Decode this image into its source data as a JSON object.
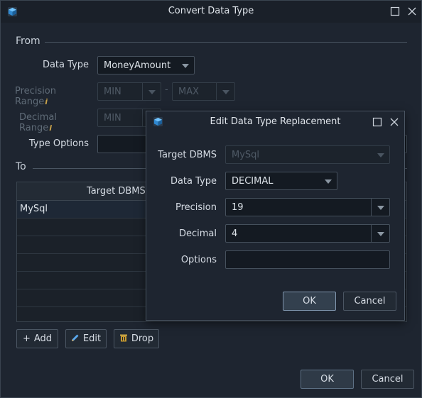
{
  "window": {
    "title": "Convert Data Type",
    "app_icon": "app-cube-icon"
  },
  "from": {
    "group_label": "From",
    "data_type_label": "Data Type",
    "data_type_value": "MoneyAmount",
    "precision_label": "Precision Range",
    "precision_min": "MIN",
    "precision_max": "MAX",
    "precision_dash": "-",
    "decimal_label": "Decimal Range",
    "decimal_min": "MIN",
    "info_glyph": "i",
    "type_options_label": "Type Options",
    "type_options_value": ""
  },
  "to": {
    "group_label": "To",
    "table": {
      "header": "Target DBMS",
      "rows": [
        {
          "target_dbms": "MySql"
        }
      ]
    },
    "add_label": "Add",
    "edit_label": "Edit",
    "drop_label": "Drop"
  },
  "footer": {
    "ok_label": "OK",
    "cancel_label": "Cancel"
  },
  "dialog": {
    "title": "Edit Data Type Replacement",
    "target_dbms_label": "Target DBMS",
    "target_dbms_value": "MySql",
    "data_type_label": "Data Type",
    "data_type_value": "DECIMAL",
    "precision_label": "Precision",
    "precision_value": "19",
    "decimal_label": "Decimal",
    "decimal_value": "4",
    "options_label": "Options",
    "options_value": "",
    "ok_label": "OK",
    "cancel_label": "Cancel"
  },
  "colors": {
    "background": "#1e2530",
    "accent_icon": "#3aa0e6",
    "info_icon": "#c9a24a"
  }
}
